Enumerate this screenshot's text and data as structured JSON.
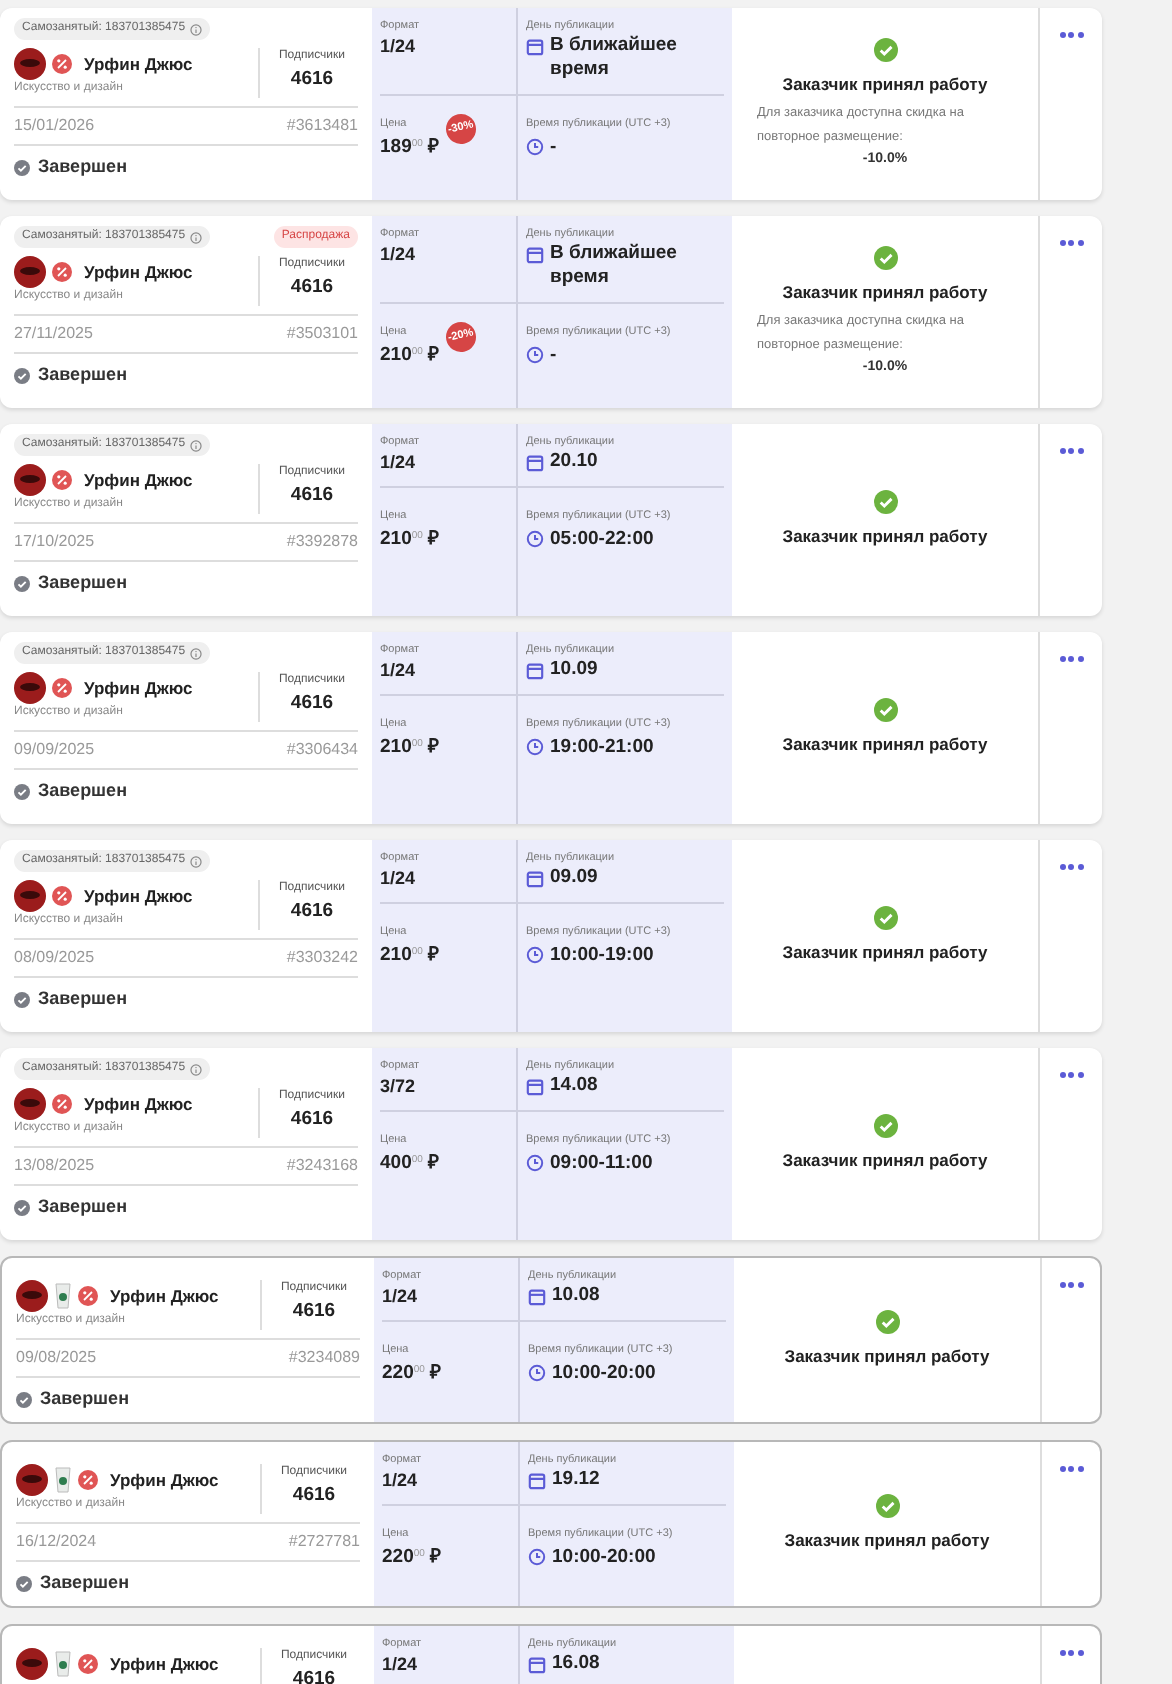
{
  "orders": [
    {
      "bordered": false,
      "badge": "Самозанятый: 183701385475",
      "cup": false,
      "name": "Урфин Джюс",
      "category": "Искусство и дизайн",
      "subs_label": "Подписчики",
      "subs": "4616",
      "date": "15/01/2026",
      "number": "#3613481",
      "status": "Завершен",
      "format_label": "Формат",
      "format": "1/24",
      "day_label": "День публикации",
      "day": "В ближайшее время",
      "price_label": "Цена",
      "price": "189",
      "cents": "00",
      "currency": "₽",
      "discount_badge": "-30%",
      "time_label": "Время публикации (UTC +3)",
      "time": "-",
      "result": "Заказчик принял работу",
      "note": "Для заказчика доступна скидка на повторное размещение:",
      "repeat_discount": "-10.0%"
    },
    {
      "bordered": false,
      "badge": "Самозанятый: 183701385475",
      "sale_tag": "Распродажа",
      "cup": false,
      "name": "Урфин Джюс",
      "category": "Искусство и дизайн",
      "subs_label": "Подписчики",
      "subs": "4616",
      "date": "27/11/2025",
      "number": "#3503101",
      "status": "Завершен",
      "format_label": "Формат",
      "format": "1/24",
      "day_label": "День публикации",
      "day": "В ближайшее время",
      "price_label": "Цена",
      "price": "210",
      "cents": "00",
      "currency": "₽",
      "discount_badge": "-20%",
      "time_label": "Время публикации (UTC +3)",
      "time": "-",
      "result": "Заказчик принял работу",
      "note": "Для заказчика доступна скидка на повторное размещение:",
      "repeat_discount": "-10.0%"
    },
    {
      "bordered": false,
      "badge": "Самозанятый: 183701385475",
      "cup": false,
      "name": "Урфин Джюс",
      "category": "Искусство и дизайн",
      "subs_label": "Подписчики",
      "subs": "4616",
      "date": "17/10/2025",
      "number": "#3392878",
      "status": "Завершен",
      "format_label": "Формат",
      "format": "1/24",
      "day_label": "День публикации",
      "day": "20.10",
      "price_label": "Цена",
      "price": "210",
      "cents": "00",
      "currency": "₽",
      "time_label": "Время публикации (UTC +3)",
      "time": "05:00-22:00",
      "result": "Заказчик принял работу"
    },
    {
      "bordered": false,
      "badge": "Самозанятый: 183701385475",
      "cup": false,
      "name": "Урфин Джюс",
      "category": "Искусство и дизайн",
      "subs_label": "Подписчики",
      "subs": "4616",
      "date": "09/09/2025",
      "number": "#3306434",
      "status": "Завершен",
      "format_label": "Формат",
      "format": "1/24",
      "day_label": "День публикации",
      "day": "10.09",
      "price_label": "Цена",
      "price": "210",
      "cents": "00",
      "currency": "₽",
      "time_label": "Время публикации (UTC +3)",
      "time": "19:00-21:00",
      "result": "Заказчик принял работу"
    },
    {
      "bordered": false,
      "badge": "Самозанятый: 183701385475",
      "cup": false,
      "name": "Урфин Джюс",
      "category": "Искусство и дизайн",
      "subs_label": "Подписчики",
      "subs": "4616",
      "date": "08/09/2025",
      "number": "#3303242",
      "status": "Завершен",
      "format_label": "Формат",
      "format": "1/24",
      "day_label": "День публикации",
      "day": "09.09",
      "price_label": "Цена",
      "price": "210",
      "cents": "00",
      "currency": "₽",
      "time_label": "Время публикации (UTC +3)",
      "time": "10:00-19:00",
      "result": "Заказчик принял работу"
    },
    {
      "bordered": false,
      "badge": "Самозанятый: 183701385475",
      "cup": false,
      "name": "Урфин Джюс",
      "category": "Искусство и дизайн",
      "subs_label": "Подписчики",
      "subs": "4616",
      "date": "13/08/2025",
      "number": "#3243168",
      "status": "Завершен",
      "format_label": "Формат",
      "format": "3/72",
      "day_label": "День публикации",
      "day": "14.08",
      "price_label": "Цена",
      "price": "400",
      "cents": "00",
      "currency": "₽",
      "time_label": "Время публикации (UTC +3)",
      "time": "09:00-11:00",
      "result": "Заказчик принял работу"
    },
    {
      "bordered": true,
      "cup": true,
      "name": "Урфин Джюс",
      "category": "Искусство и дизайн",
      "subs_label": "Подписчики",
      "subs": "4616",
      "date": "09/08/2025",
      "number": "#3234089",
      "status": "Завершен",
      "format_label": "Формат",
      "format": "1/24",
      "day_label": "День публикации",
      "day": "10.08",
      "price_label": "Цена",
      "price": "220",
      "cents": "00",
      "currency": "₽",
      "time_label": "Время публикации (UTC +3)",
      "time": "10:00-20:00",
      "result": "Заказчик принял работу"
    },
    {
      "bordered": true,
      "cup": true,
      "name": "Урфин Джюс",
      "category": "Искусство и дизайн",
      "subs_label": "Подписчики",
      "subs": "4616",
      "date": "16/12/2024",
      "number": "#2727781",
      "status": "Завершен",
      "format_label": "Формат",
      "format": "1/24",
      "day_label": "День публикации",
      "day": "19.12",
      "price_label": "Цена",
      "price": "220",
      "cents": "00",
      "currency": "₽",
      "time_label": "Время публикации (UTC +3)",
      "time": "10:00-20:00",
      "result": "Заказчик принял работу"
    },
    {
      "bordered": true,
      "cup": true,
      "name": "Урфин Джюс",
      "subs_label": "Подписчики",
      "subs": "4616",
      "format_label": "Формат",
      "format": "1/24",
      "day_label": "День публикации",
      "day": "16.08"
    }
  ]
}
